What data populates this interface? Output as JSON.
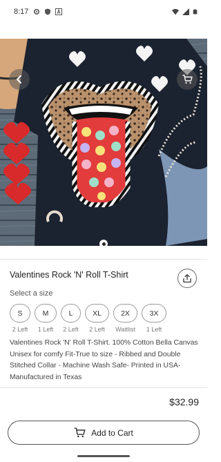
{
  "status_bar": {
    "time": "8:17",
    "left_icons": [
      "settings-gear-icon",
      "shield-icon",
      "font-a-icon"
    ],
    "right_icons": [
      "wifi-icon",
      "cellular-signal-icon",
      "battery-icon"
    ]
  },
  "hero": {
    "image_alt": "",
    "pager_dot_count": 1
  },
  "product": {
    "title": "Valentines Rock 'N' Roll T-Shirt",
    "size_label": "Select a size",
    "sizes": [
      {
        "label": "S",
        "availability": "2 Left"
      },
      {
        "label": "M",
        "availability": "1 Left"
      },
      {
        "label": "L",
        "availability": "2 Left"
      },
      {
        "label": "XL",
        "availability": "2 Left"
      },
      {
        "label": "2X",
        "availability": "Waitlist"
      },
      {
        "label": "3X",
        "availability": "1 Left"
      }
    ],
    "description": "Valentines Rock 'N' Roll T-Shirt. 100% Cotton Bella Canvas Unisex for comfy Fit-True to size - Ribbed and Double Stitched Collar - Machine Wash Safe- Printed in USA- Manufactured in Texas",
    "price": "$32.99",
    "add_to_cart_label": "Add to Cart"
  }
}
